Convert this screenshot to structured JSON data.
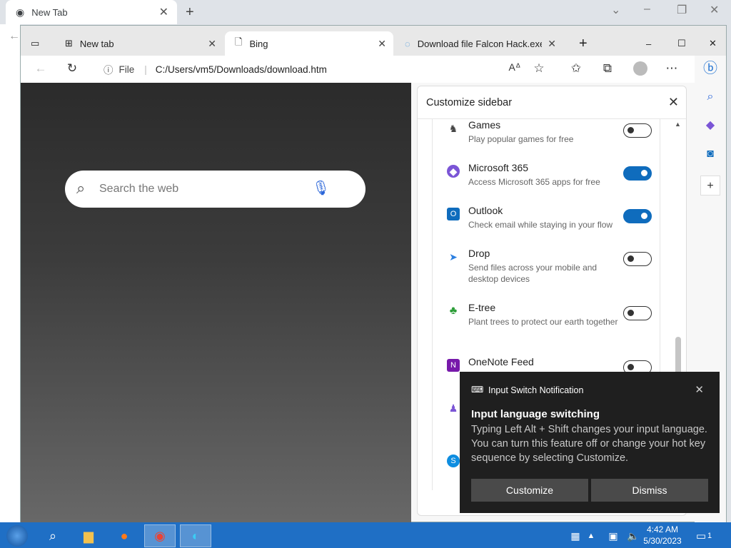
{
  "chrome": {
    "tab_title": "New Tab",
    "close_glyph": "✕",
    "new_tab_glyph": "+",
    "min_glyph": "–",
    "max_glyph": "❐",
    "win_close_glyph": "✕"
  },
  "edge": {
    "tabs": [
      {
        "label": "New tab",
        "icon": "tab-grid-icon"
      },
      {
        "label": "Bing",
        "icon": "page-icon"
      },
      {
        "label": "Download file Falcon Hack.exe o",
        "icon": "download-site-icon"
      }
    ],
    "address_prefix": "File",
    "address_url": "C:/Users/vm5/Downloads/download.htm",
    "search_placeholder": "Search the web"
  },
  "sidebar_panel": {
    "title": "Customize sidebar",
    "items": [
      {
        "name": "Games",
        "desc": "Play popular games for free",
        "enabled": false,
        "icon": "games-icon",
        "color": "#3d3d3d"
      },
      {
        "name": "Microsoft 365",
        "desc": "Access Microsoft 365 apps for free",
        "enabled": true,
        "icon": "microsoft365-icon",
        "color": "#7b55d6"
      },
      {
        "name": "Outlook",
        "desc": "Check email while staying in your flow",
        "enabled": true,
        "icon": "outlook-icon",
        "color": "#0f6cbd"
      },
      {
        "name": "Drop",
        "desc": "Send files across your mobile and desktop devices",
        "enabled": false,
        "icon": "drop-icon",
        "color": "#2b7fe0"
      },
      {
        "name": "E-tree",
        "desc": "Plant trees to protect our earth together",
        "enabled": false,
        "icon": "etree-icon",
        "color": "#2e9e3a"
      },
      {
        "name": "OneNote Feed",
        "desc": "",
        "enabled": false,
        "icon": "onenote-icon",
        "color": "#7719aa"
      }
    ]
  },
  "notification": {
    "app": "Input Switch Notification",
    "title": "Input language switching",
    "body": "Typing Left Alt + Shift changes your input language. You can turn this feature off or change your hot key sequence by selecting Customize.",
    "customize_label": "Customize",
    "dismiss_label": "Dismiss"
  },
  "taskbar": {
    "time": "4:42 AM",
    "date": "5/30/2023",
    "notification_count": "1"
  }
}
